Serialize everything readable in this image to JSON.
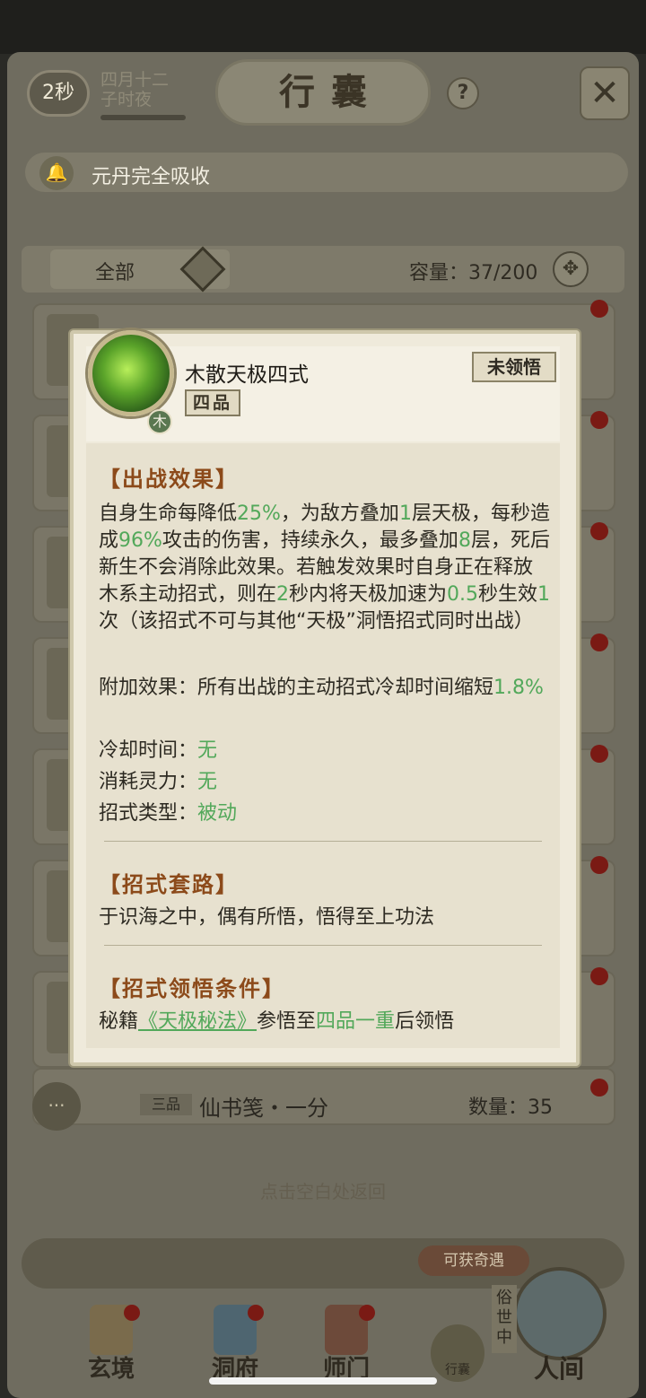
{
  "header": {
    "timer": "2秒",
    "date_line1": "四月十二",
    "date_line2": "子时夜",
    "title": "行囊",
    "help": "?",
    "close": "✕"
  },
  "banner": {
    "text": "元丹完全吸收"
  },
  "filter": {
    "label": "全部",
    "capacity": "容量：37/200"
  },
  "background_list": {
    "last_item": {
      "grade": "三品",
      "name": "仙书笺・一分",
      "quantity": "数量：35"
    }
  },
  "back_hint": "点击空白处返回",
  "encounter": "可获奇遇",
  "nav": {
    "items": [
      {
        "label": "玄境"
      },
      {
        "label": "洞府"
      },
      {
        "label": "师门"
      }
    ],
    "bag": "行囊",
    "world_side": "俗世中",
    "world": "人间"
  },
  "popup": {
    "skill_name": "木散天极四式",
    "grade": "四品",
    "element": "木",
    "status": "未领悟",
    "battle_title": "【出战效果】",
    "battle_parts": [
      "自身生命每降低",
      "25%",
      "，为敌方叠加",
      "1",
      "层天极，每秒造成",
      "96%",
      "攻击的伤害，持续永久，最多叠加",
      "8",
      "层，死后新生不会消除此效果。若触发效果时自身正在释放木系主动招式，则在",
      "2",
      "秒内将天极加速为",
      "0.5",
      "秒生效",
      "1",
      "次（该招式不可与其他“天极”洞悟招式同时出战）"
    ],
    "extra_label": "附加效果：所有出战的主动招式冷却时间缩短",
    "extra_value": "1.8%",
    "cooldown_label": "冷却时间：",
    "cooldown_value": "无",
    "cost_label": "消耗灵力：",
    "cost_value": "无",
    "type_label": "招式类型：",
    "type_value": "被动",
    "routine_title": "【招式套路】",
    "routine_text": "于识海之中，偶有所悟，悟得至上功法",
    "cond_title": "【招式领悟条件】",
    "cond_prefix": "秘籍",
    "cond_link": "《天极秘法》",
    "cond_mid": "参悟至",
    "cond_level": "四品一重",
    "cond_suffix": "后领悟"
  }
}
